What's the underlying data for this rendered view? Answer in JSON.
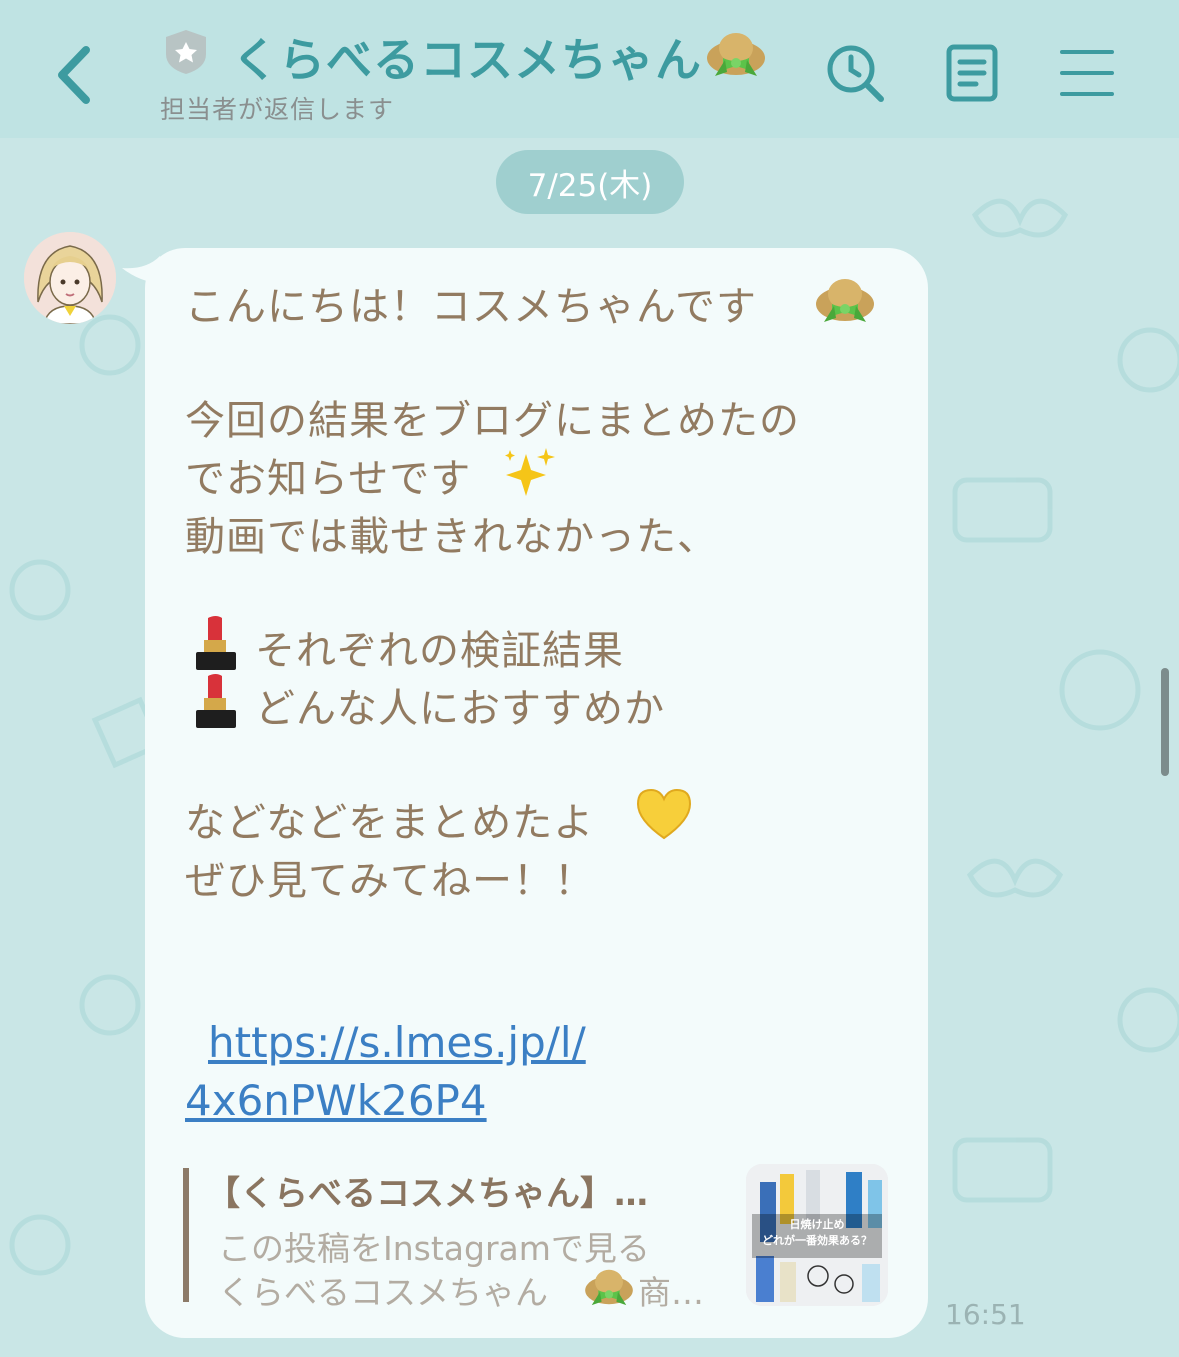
{
  "header": {
    "title": "くらべるコスメちゃん",
    "subtitle": "担当者が返信します",
    "icons": [
      "back-arrow-icon",
      "shield-icon",
      "search-history-icon",
      "notes-icon",
      "menu-icon"
    ]
  },
  "date": "7/25(木)",
  "message": {
    "lines": [
      "こんにちは！コスメちゃんです",
      "今回の結果をブログにまとめたの",
      "でお知らせです",
      "動画では載せきれなかった、",
      "それぞれの検証結果",
      "どんな人におすすめか",
      "などなどをまとめたよ",
      "ぜひ見てみてねー！！"
    ],
    "link_line1": "https://s.lmes.jp/l/",
    "link_line2": "4x6nPWk26P4",
    "emojis": [
      "hat-emoji",
      "sparkles-emoji",
      "lipstick-emoji",
      "yellow-heart-emoji"
    ]
  },
  "preview": {
    "title": "【くらべるコスメちゃん】…",
    "desc_line1": "この投稿をInstagramで見る",
    "desc_line2": "くらべるコスメちゃん",
    "desc_line2_suffix": "商…",
    "thumb_text_line1": "日焼け止め",
    "thumb_text_line2": "どれが一番効果ある？"
  },
  "time": "16:51",
  "colors": {
    "background": "#c9e6e6",
    "header_bg": "#bfe3e3",
    "accent": "#3d9ba0",
    "bubble": "#f3fbfb",
    "message_text": "#927b61",
    "link": "#3b7fc4"
  }
}
